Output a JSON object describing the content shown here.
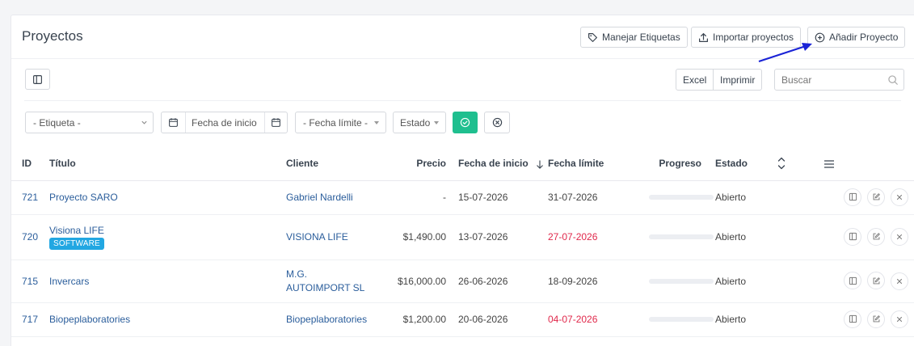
{
  "header": {
    "title": "Proyectos",
    "buttons": {
      "labels": "Manejar Etiquetas",
      "import": "Importar proyectos",
      "add": "Añadir Proyecto"
    }
  },
  "toolbar": {
    "excel": "Excel",
    "print": "Imprimir",
    "search_placeholder": "Buscar"
  },
  "filters": {
    "label_select": "- Etiqueta -",
    "start_date": "Fecha de inicio",
    "deadline": "- Fecha límite -",
    "status": "Estado"
  },
  "table": {
    "columns": {
      "id": "ID",
      "title": "Título",
      "client": "Cliente",
      "price": "Precio",
      "start": "Fecha de inicio",
      "deadline": "Fecha límite",
      "progress": "Progreso",
      "status": "Estado"
    },
    "rows": [
      {
        "id": "721",
        "title": "Proyecto SARO",
        "badge": "",
        "client": "Gabriel Nardelli",
        "client2": "",
        "price": "-",
        "start": "15-07-2026",
        "deadline": "31-07-2026",
        "deadline_overdue": false,
        "progress": 0,
        "status": "Abierto"
      },
      {
        "id": "720",
        "title": "Visiona LIFE",
        "badge": "SOFTWARE",
        "client": "VISIONA LIFE",
        "client2": "",
        "price": "$1,490.00",
        "start": "13-07-2026",
        "deadline": "27-07-2026",
        "deadline_overdue": true,
        "progress": 0,
        "status": "Abierto"
      },
      {
        "id": "715",
        "title": "Invercars",
        "badge": "",
        "client": "M.G.",
        "client2": "AUTOIMPORT SL",
        "price": "$16,000.00",
        "start": "26-06-2026",
        "deadline": "18-09-2026",
        "deadline_overdue": false,
        "progress": 0,
        "status": "Abierto"
      },
      {
        "id": "717",
        "title": "Biopeplaboratories",
        "badge": "",
        "client": "Biopeplaboratories",
        "client2": "",
        "price": "$1,200.00",
        "start": "20-06-2026",
        "deadline": "04-07-2026",
        "deadline_overdue": true,
        "progress": 0,
        "status": "Abierto"
      }
    ]
  },
  "colors": {
    "accent": "#22a7e2",
    "success": "#1fbf8f",
    "overdue": "#e0284b",
    "link": "#2a5d9b",
    "annotation_arrow": "#1a23d6"
  }
}
